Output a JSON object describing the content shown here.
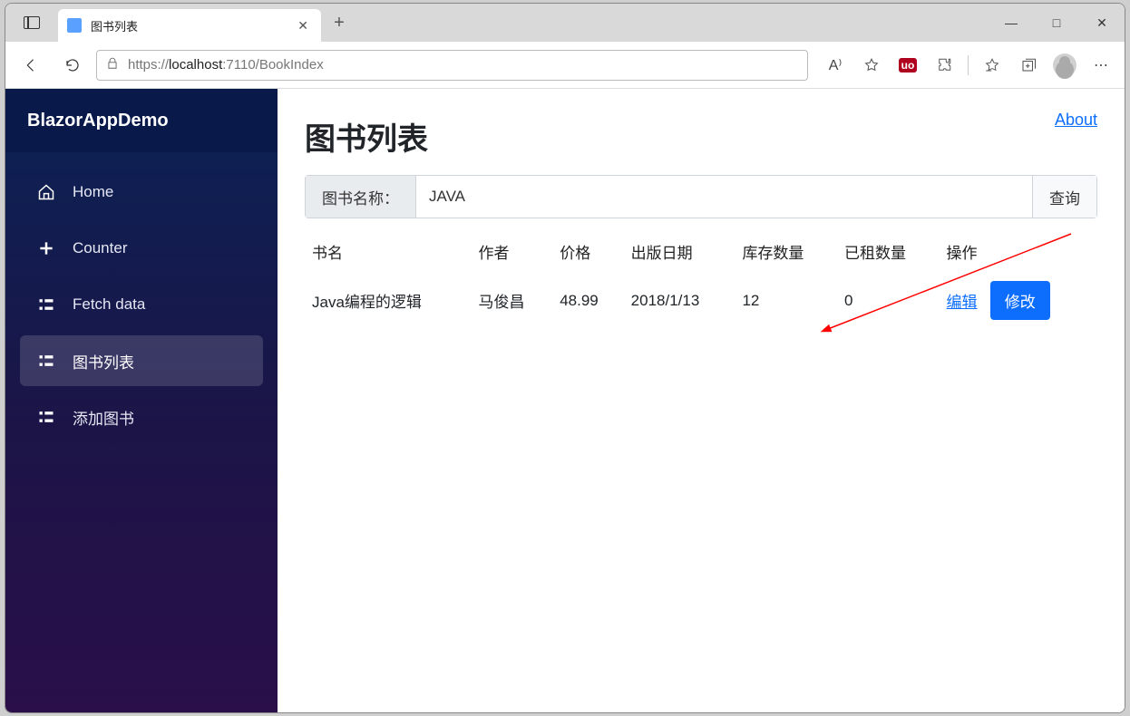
{
  "browser": {
    "tab_title": "图书列表",
    "url_prefix": "https://",
    "url_host": "localhost",
    "url_port_path": ":7110/BookIndex",
    "plus": "+",
    "close": "✕",
    "minimize": "—",
    "maximize": "□",
    "win_close": "✕",
    "read_aloud": "A⁾",
    "more": "⋯"
  },
  "app": {
    "brand": "BlazorAppDemo",
    "about": "About"
  },
  "sidebar": {
    "items": [
      {
        "label": "Home"
      },
      {
        "label": "Counter"
      },
      {
        "label": "Fetch data"
      },
      {
        "label": "图书列表"
      },
      {
        "label": "添加图书"
      }
    ],
    "active_index": 3
  },
  "page": {
    "title": "图书列表",
    "search_label": "图书名称：",
    "search_value": "JAVA",
    "search_button": "查询"
  },
  "table": {
    "headers": [
      "书名",
      "作者",
      "价格",
      "出版日期",
      "库存数量",
      "已租数量",
      "操作"
    ],
    "rows": [
      {
        "title": "Java编程的逻辑",
        "author": "马俊昌",
        "price": "48.99",
        "pub_date": "2018/1/13",
        "stock": "12",
        "rented": "0",
        "edit_label": "编辑",
        "modify_label": "修改"
      }
    ]
  },
  "icons": {
    "home": "home-icon",
    "plus": "plus-icon",
    "list": "list-icon",
    "star": "star-icon",
    "shield": "shield-icon",
    "puzzle": "puzzle-icon",
    "favorites": "favorites-icon",
    "collections": "collections-icon",
    "profile": "profile-icon"
  }
}
